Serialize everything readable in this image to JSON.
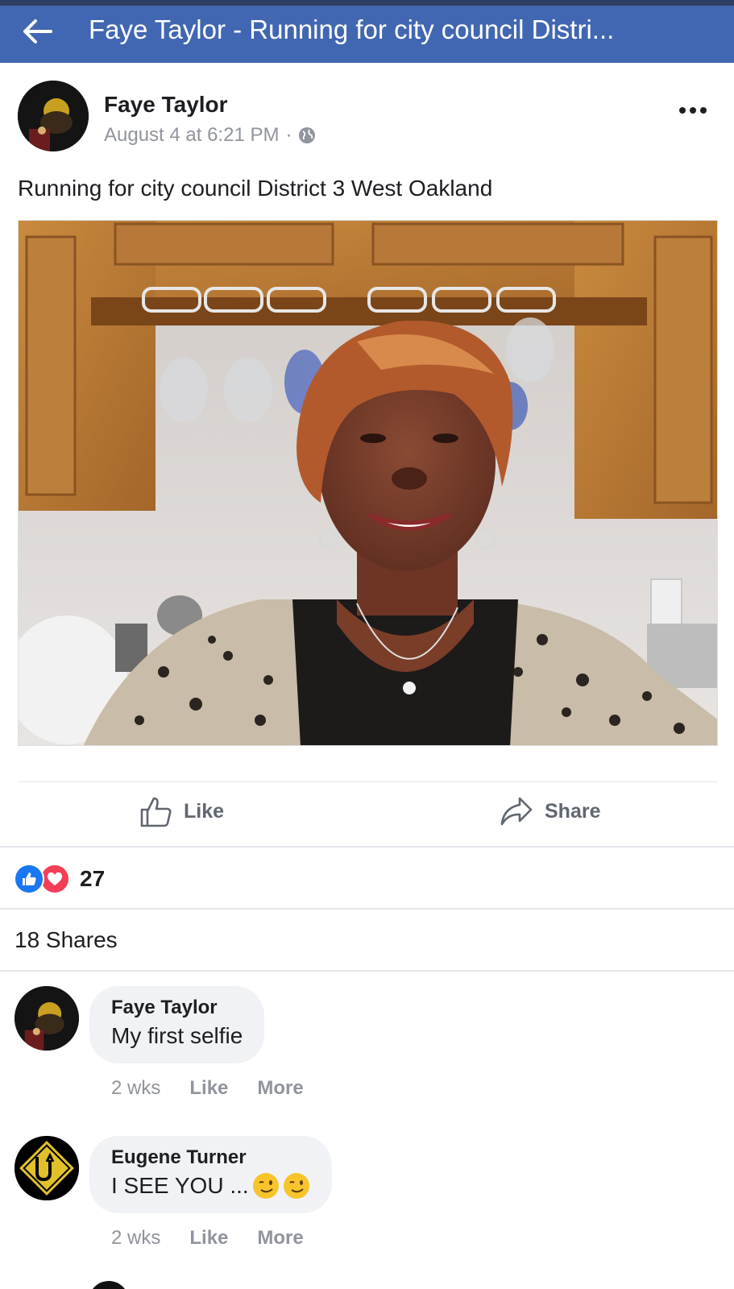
{
  "topbar": {
    "title": "Faye Taylor - Running for city council Distri..."
  },
  "post": {
    "author": "Faye Taylor",
    "timestamp": "August 4 at 6:21 PM",
    "separator": "·",
    "privacy_icon": "globe-icon",
    "text": "Running for city council District 3 West Oakland"
  },
  "actions": {
    "like_label": "Like",
    "share_label": "Share"
  },
  "reactions": {
    "types": [
      "like",
      "love"
    ],
    "count": "27"
  },
  "shares": {
    "text": "18 Shares"
  },
  "comments": [
    {
      "author": "Faye Taylor",
      "text": "My first selfie",
      "time": "2 wks",
      "like_label": "Like",
      "more_label": "More"
    },
    {
      "author": "Eugene Turner",
      "text": "I SEE YOU ...",
      "emoji": [
        "winking-face",
        "winking-face"
      ],
      "time": "2 wks",
      "like_label": "Like",
      "more_label": "More"
    }
  ],
  "colors": {
    "header_blue": "#4267b2",
    "like_blue": "#1877f2",
    "love_red": "#f33e58",
    "secondary_text": "#90949c",
    "bubble_bg": "#f0f2f5"
  }
}
